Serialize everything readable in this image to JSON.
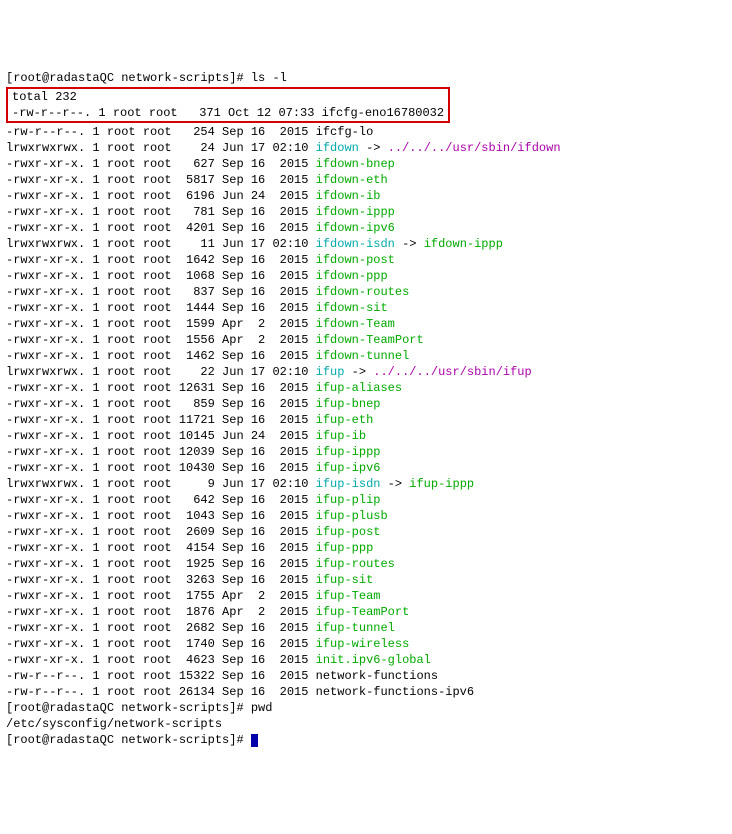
{
  "prompt1": "[root@radastaQC network-scripts]# ",
  "cmd1": "ls -l",
  "total": "total 232",
  "box_line": "-rw-r--r--. 1 root root   371 Oct 12 07:33 ifcfg-eno16780032",
  "files": [
    {
      "p": "-rw-r--r--. 1 root root   254 Sep 16  2015 ",
      "n": "ifcfg-lo",
      "t": "plain"
    },
    {
      "p": "lrwxrwxrwx. 1 root root    24 Jun 17 02:10 ",
      "n": "ifdown",
      "t": "link",
      "l": " -> ../../../usr/sbin/ifdown",
      "lc": "mag"
    },
    {
      "p": "-rwxr-xr-x. 1 root root   627 Sep 16  2015 ",
      "n": "ifdown-bnep",
      "t": "exec"
    },
    {
      "p": "-rwxr-xr-x. 1 root root  5817 Sep 16  2015 ",
      "n": "ifdown-eth",
      "t": "exec"
    },
    {
      "p": "-rwxr-xr-x. 1 root root  6196 Jun 24  2015 ",
      "n": "ifdown-ib",
      "t": "exec"
    },
    {
      "p": "-rwxr-xr-x. 1 root root   781 Sep 16  2015 ",
      "n": "ifdown-ippp",
      "t": "exec"
    },
    {
      "p": "-rwxr-xr-x. 1 root root  4201 Sep 16  2015 ",
      "n": "ifdown-ipv6",
      "t": "exec"
    },
    {
      "p": "lrwxrwxrwx. 1 root root    11 Jun 17 02:10 ",
      "n": "ifdown-isdn",
      "t": "link",
      "l": " -> ifdown-ippp",
      "lc": "green"
    },
    {
      "p": "-rwxr-xr-x. 1 root root  1642 Sep 16  2015 ",
      "n": "ifdown-post",
      "t": "exec"
    },
    {
      "p": "-rwxr-xr-x. 1 root root  1068 Sep 16  2015 ",
      "n": "ifdown-ppp",
      "t": "exec"
    },
    {
      "p": "-rwxr-xr-x. 1 root root   837 Sep 16  2015 ",
      "n": "ifdown-routes",
      "t": "exec"
    },
    {
      "p": "-rwxr-xr-x. 1 root root  1444 Sep 16  2015 ",
      "n": "ifdown-sit",
      "t": "exec"
    },
    {
      "p": "-rwxr-xr-x. 1 root root  1599 Apr  2  2015 ",
      "n": "ifdown-Team",
      "t": "exec"
    },
    {
      "p": "-rwxr-xr-x. 1 root root  1556 Apr  2  2015 ",
      "n": "ifdown-TeamPort",
      "t": "exec"
    },
    {
      "p": "-rwxr-xr-x. 1 root root  1462 Sep 16  2015 ",
      "n": "ifdown-tunnel",
      "t": "exec"
    },
    {
      "p": "lrwxrwxrwx. 1 root root    22 Jun 17 02:10 ",
      "n": "ifup",
      "t": "link",
      "l": " -> ../../../usr/sbin/ifup",
      "lc": "mag"
    },
    {
      "p": "-rwxr-xr-x. 1 root root 12631 Sep 16  2015 ",
      "n": "ifup-aliases",
      "t": "exec"
    },
    {
      "p": "-rwxr-xr-x. 1 root root   859 Sep 16  2015 ",
      "n": "ifup-bnep",
      "t": "exec"
    },
    {
      "p": "-rwxr-xr-x. 1 root root 11721 Sep 16  2015 ",
      "n": "ifup-eth",
      "t": "exec"
    },
    {
      "p": "-rwxr-xr-x. 1 root root 10145 Jun 24  2015 ",
      "n": "ifup-ib",
      "t": "exec"
    },
    {
      "p": "-rwxr-xr-x. 1 root root 12039 Sep 16  2015 ",
      "n": "ifup-ippp",
      "t": "exec"
    },
    {
      "p": "-rwxr-xr-x. 1 root root 10430 Sep 16  2015 ",
      "n": "ifup-ipv6",
      "t": "exec"
    },
    {
      "p": "lrwxrwxrwx. 1 root root     9 Jun 17 02:10 ",
      "n": "ifup-isdn",
      "t": "link",
      "l": " -> ifup-ippp",
      "lc": "green"
    },
    {
      "p": "-rwxr-xr-x. 1 root root   642 Sep 16  2015 ",
      "n": "ifup-plip",
      "t": "exec"
    },
    {
      "p": "-rwxr-xr-x. 1 root root  1043 Sep 16  2015 ",
      "n": "ifup-plusb",
      "t": "exec"
    },
    {
      "p": "-rwxr-xr-x. 1 root root  2609 Sep 16  2015 ",
      "n": "ifup-post",
      "t": "exec"
    },
    {
      "p": "-rwxr-xr-x. 1 root root  4154 Sep 16  2015 ",
      "n": "ifup-ppp",
      "t": "exec"
    },
    {
      "p": "-rwxr-xr-x. 1 root root  1925 Sep 16  2015 ",
      "n": "ifup-routes",
      "t": "exec"
    },
    {
      "p": "-rwxr-xr-x. 1 root root  3263 Sep 16  2015 ",
      "n": "ifup-sit",
      "t": "exec"
    },
    {
      "p": "-rwxr-xr-x. 1 root root  1755 Apr  2  2015 ",
      "n": "ifup-Team",
      "t": "exec"
    },
    {
      "p": "-rwxr-xr-x. 1 root root  1876 Apr  2  2015 ",
      "n": "ifup-TeamPort",
      "t": "exec"
    },
    {
      "p": "-rwxr-xr-x. 1 root root  2682 Sep 16  2015 ",
      "n": "ifup-tunnel",
      "t": "exec"
    },
    {
      "p": "-rwxr-xr-x. 1 root root  1740 Sep 16  2015 ",
      "n": "ifup-wireless",
      "t": "exec"
    },
    {
      "p": "-rwxr-xr-x. 1 root root  4623 Sep 16  2015 ",
      "n": "init.ipv6-global",
      "t": "exec"
    },
    {
      "p": "-rw-r--r--. 1 root root 15322 Sep 16  2015 ",
      "n": "network-functions",
      "t": "plain"
    },
    {
      "p": "-rw-r--r--. 1 root root 26134 Sep 16  2015 ",
      "n": "network-functions-ipv6",
      "t": "plain"
    }
  ],
  "cmd2": "pwd",
  "pwd_output": "/etc/sysconfig/network-scripts",
  "prompt3": "[root@radastaQC network-scripts]# "
}
